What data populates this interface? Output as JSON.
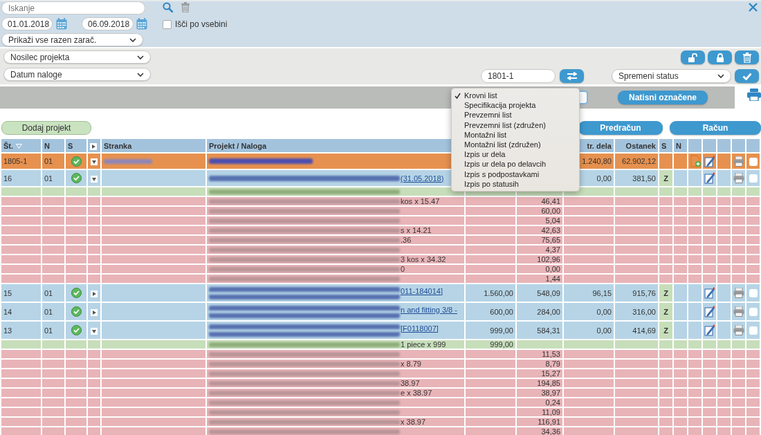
{
  "search": {
    "placeholder": "Iskanje"
  },
  "date_from": "01.01.2018",
  "date_to": "06.09.2018",
  "content_search": {
    "label": "Išči po vsebini",
    "checked": false
  },
  "filter_select": "Prikaži vse razen zarač.",
  "owner_select": "Nosilec projekta",
  "date_select": "Datum naloge",
  "order_field": "1801-1",
  "status_select": "Spremeni status",
  "print_button": "Natisni označene",
  "print_menu": [
    {
      "label": "Krovni list",
      "selected": true
    },
    {
      "label": "Specifikacija projekta",
      "selected": false
    },
    {
      "label": "Prevzemni list",
      "selected": false
    },
    {
      "label": "Prevzemni list (združen)",
      "selected": false
    },
    {
      "label": "Montažni list",
      "selected": false
    },
    {
      "label": "Montažni list (združen)",
      "selected": false
    },
    {
      "label": "Izpis ur dela",
      "selected": false
    },
    {
      "label": "Izpis ur dela po delavcih",
      "selected": false
    },
    {
      "label": "Izpis s podpostavkami",
      "selected": false
    },
    {
      "label": "Izpis po statusih",
      "selected": false
    }
  ],
  "add_project_button": "Dodaj projekt",
  "proforma_button": "Predračun",
  "invoice_button": "Račun",
  "table": {
    "columns": [
      {
        "kind": "text",
        "label": "Št.",
        "sorted": true
      },
      {
        "kind": "text",
        "label": "N"
      },
      {
        "kind": "text",
        "label": "S"
      },
      {
        "kind": "expander"
      },
      {
        "kind": "text",
        "label": "Stranka"
      },
      {
        "kind": "text",
        "label": "Projekt / Naloga"
      },
      {
        "kind": "blank"
      },
      {
        "kind": "blank"
      },
      {
        "kind": "text",
        "label": "tr. dela"
      },
      {
        "kind": "text",
        "label": "Ostanek"
      },
      {
        "kind": "text",
        "label": "S"
      },
      {
        "kind": "text",
        "label": "N"
      },
      {
        "kind": "blank"
      },
      {
        "kind": "blank"
      },
      {
        "kind": "blank"
      },
      {
        "kind": "blank"
      },
      {
        "kind": "blank"
      }
    ],
    "rows": [
      {
        "kind": "umbrella",
        "number": "1805-1",
        "n": "01",
        "approved": true,
        "expanded": true,
        "client_blurred": true,
        "work": "1.240,80",
        "balance": "62.902,12",
        "actions": [
          {
            "kind": "add"
          },
          {
            "kind": "edit"
          },
          {
            "kind": "print"
          }
        ],
        "checked": false
      },
      {
        "kind": "order",
        "number": "16",
        "n": "01",
        "approved": true,
        "expanded": true,
        "project": "(31.05.2018)",
        "work": "0,00",
        "balance": "381,50",
        "s": "Z",
        "actions": [
          {
            "kind": "edit"
          },
          {
            "kind": "print"
          }
        ],
        "checked": false
      },
      {
        "kind": "article"
      },
      {
        "kind": "part",
        "project": "kos x 15.47",
        "cost": "46,41"
      },
      {
        "kind": "part",
        "cost": "60,00"
      },
      {
        "kind": "part",
        "cost": "5,04"
      },
      {
        "kind": "part",
        "project": "s x 14.21",
        "cost": "42,63"
      },
      {
        "kind": "part",
        "project": ".36",
        "cost": "75,65"
      },
      {
        "kind": "part",
        "cost": "4,37"
      },
      {
        "kind": "part",
        "project": "3 kos x 34.32",
        "cost": "102,96"
      },
      {
        "kind": "part",
        "project": "0",
        "cost": "0,00"
      },
      {
        "kind": "part",
        "cost": "1,44"
      },
      {
        "kind": "order",
        "number": "15",
        "n": "01",
        "approved": true,
        "expanded": false,
        "project": "011-184014]",
        "wrapped": true,
        "amount": "1.560,00",
        "cost": "548,09",
        "work": "96,15",
        "balance": "915,76",
        "s": "Z",
        "actions": [
          {
            "kind": "edit"
          },
          {
            "kind": "print"
          }
        ],
        "checked": false
      },
      {
        "kind": "order",
        "number": "14",
        "n": "01",
        "approved": true,
        "expanded": false,
        "project": "n and fitting 3/8 -",
        "wrapped": true,
        "amount": "600,00",
        "cost": "284,00",
        "work": "0,00",
        "balance": "316,00",
        "s": "Z",
        "actions": [
          {
            "kind": "edit"
          },
          {
            "kind": "print"
          }
        ],
        "checked": false
      },
      {
        "kind": "order",
        "number": "13",
        "n": "01",
        "approved": true,
        "expanded": true,
        "project": "[F0118007]",
        "wrapped": true,
        "amount": "999,00",
        "cost": "584,31",
        "work": "0,00",
        "balance": "414,69",
        "s": "Z",
        "actions": [
          {
            "kind": "edit"
          },
          {
            "kind": "print"
          }
        ],
        "checked": false
      },
      {
        "kind": "article",
        "project": "1 piece x 999",
        "amount": "999,00"
      },
      {
        "kind": "part",
        "cost": "11,53"
      },
      {
        "kind": "part",
        "project": "x 8.79",
        "cost": "8,79"
      },
      {
        "kind": "part",
        "cost": "15,27"
      },
      {
        "kind": "part",
        "project": "38.97",
        "cost": "194,85"
      },
      {
        "kind": "part",
        "project": "e x 38.97",
        "cost": "38,97"
      },
      {
        "kind": "part",
        "cost": "0,24"
      },
      {
        "kind": "part",
        "cost": "11,09"
      },
      {
        "kind": "part",
        "project": "x 38.97",
        "cost": "116,91"
      },
      {
        "kind": "part",
        "cost": "34,36"
      }
    ]
  }
}
